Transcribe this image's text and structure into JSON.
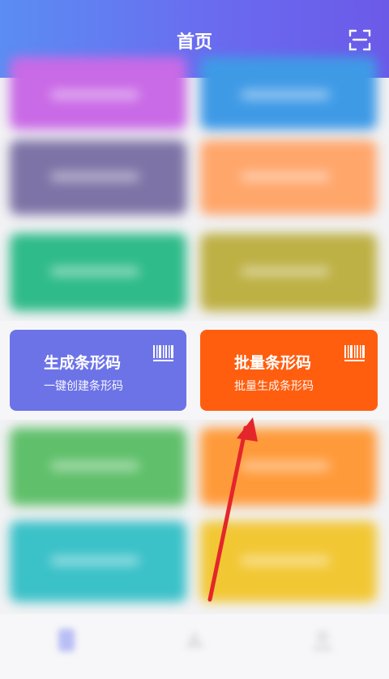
{
  "header": {
    "title": "首页",
    "scan_icon": "scan-frame-icon",
    "gradient": [
      "#5b8df3",
      "#6b5ae8"
    ]
  },
  "features": {
    "generate": {
      "title": "生成条形码",
      "subtitle": "一键创建条形码",
      "icon": "barcode-icon",
      "color": "#6c73e7"
    },
    "batch": {
      "title": "批量条形码",
      "subtitle": "批量生成条形码",
      "icon": "barcode-icon",
      "color": "#ff5e0f"
    }
  },
  "blurred_cards": {
    "colors": [
      "#c96ae6",
      "#3f9ae6",
      "#7e73a6",
      "#ffa66b",
      "#2fbb8a",
      "#bdb044",
      "#5fbf6a",
      "#ff9a3a",
      "#3bc1c8",
      "#f2c734"
    ]
  },
  "annotation": {
    "arrow_color": "#e4262b",
    "points_to": "batch"
  }
}
